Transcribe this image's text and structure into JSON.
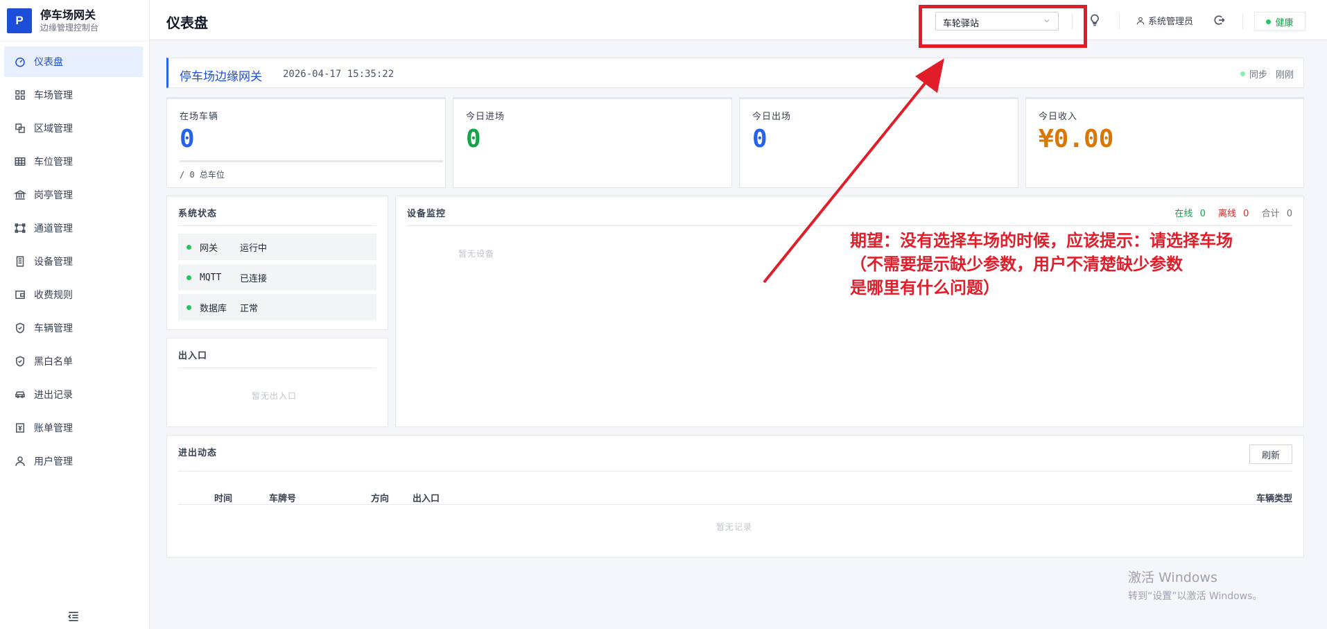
{
  "brand": {
    "logo_letter": "P",
    "title": "停车场网关",
    "subtitle": "边缘管理控制台"
  },
  "sidebar": {
    "items": [
      {
        "label": "仪表盘",
        "icon": "dashboard-icon",
        "active": true
      },
      {
        "label": "车场管理",
        "icon": "grid-icon"
      },
      {
        "label": "区域管理",
        "icon": "area-icon"
      },
      {
        "label": "车位管理",
        "icon": "table-icon"
      },
      {
        "label": "岗亭管理",
        "icon": "bank-icon"
      },
      {
        "label": "通道管理",
        "icon": "channel-icon"
      },
      {
        "label": "设备管理",
        "icon": "device-icon"
      },
      {
        "label": "收费规则",
        "icon": "wallet-icon"
      },
      {
        "label": "车辆管理",
        "icon": "shield-icon"
      },
      {
        "label": "黑白名单",
        "icon": "shield-icon"
      },
      {
        "label": "进出记录",
        "icon": "car-icon"
      },
      {
        "label": "账单管理",
        "icon": "bill-icon"
      },
      {
        "label": "用户管理",
        "icon": "user-icon"
      }
    ],
    "collapse_icon": "collapse-icon"
  },
  "header": {
    "title": "仪表盘",
    "parking_lot_select": "车轮驿站",
    "user": "系统管理员",
    "health": "健康"
  },
  "banner": {
    "title": "停车场边缘网关",
    "datetime": "2026-04-17 15:35:22",
    "sync_label": "同步",
    "sync_time": "刚刚"
  },
  "stats": [
    {
      "label": "在场车辆",
      "value": "0",
      "color": "#2563eb",
      "footer": "/ 0 总车位"
    },
    {
      "label": "今日进场",
      "value": "0",
      "color": "#16a34a"
    },
    {
      "label": "今日出场",
      "value": "0",
      "color": "#2563eb"
    },
    {
      "label": "今日收入",
      "value": "¥0.00",
      "color": "#d97706"
    }
  ],
  "system_status": {
    "title": "系统状态",
    "rows": [
      {
        "name": "网关",
        "value": "运行中"
      },
      {
        "name": "MQTT",
        "value": "已连接"
      },
      {
        "name": "数据库",
        "value": "正常"
      }
    ]
  },
  "entrances": {
    "title": "出入口",
    "empty": "暂无出入口"
  },
  "device_monitor": {
    "title": "设备监控",
    "online_label": "在线",
    "online_count": "0",
    "offline_label": "离线",
    "offline_count": "0",
    "total_label": "合计",
    "total_count": "0",
    "empty": "暂无设备"
  },
  "activity": {
    "title": "进出动态",
    "refresh_label": "刷新",
    "columns": [
      "时间",
      "车牌号",
      "方向",
      "出入口",
      "车辆类型"
    ],
    "empty": "暂无记录"
  },
  "annotation": {
    "text": "期望：没有选择车场的时候，应该提示：请选择车场\n（不需要提示缺少参数，用户不清楚缺少参数\n是哪里有什么问题）",
    "color": "#e11d2a"
  },
  "watermark": {
    "line1": "激活 Windows",
    "line2": "转到“设置”以激活 Windows。"
  }
}
